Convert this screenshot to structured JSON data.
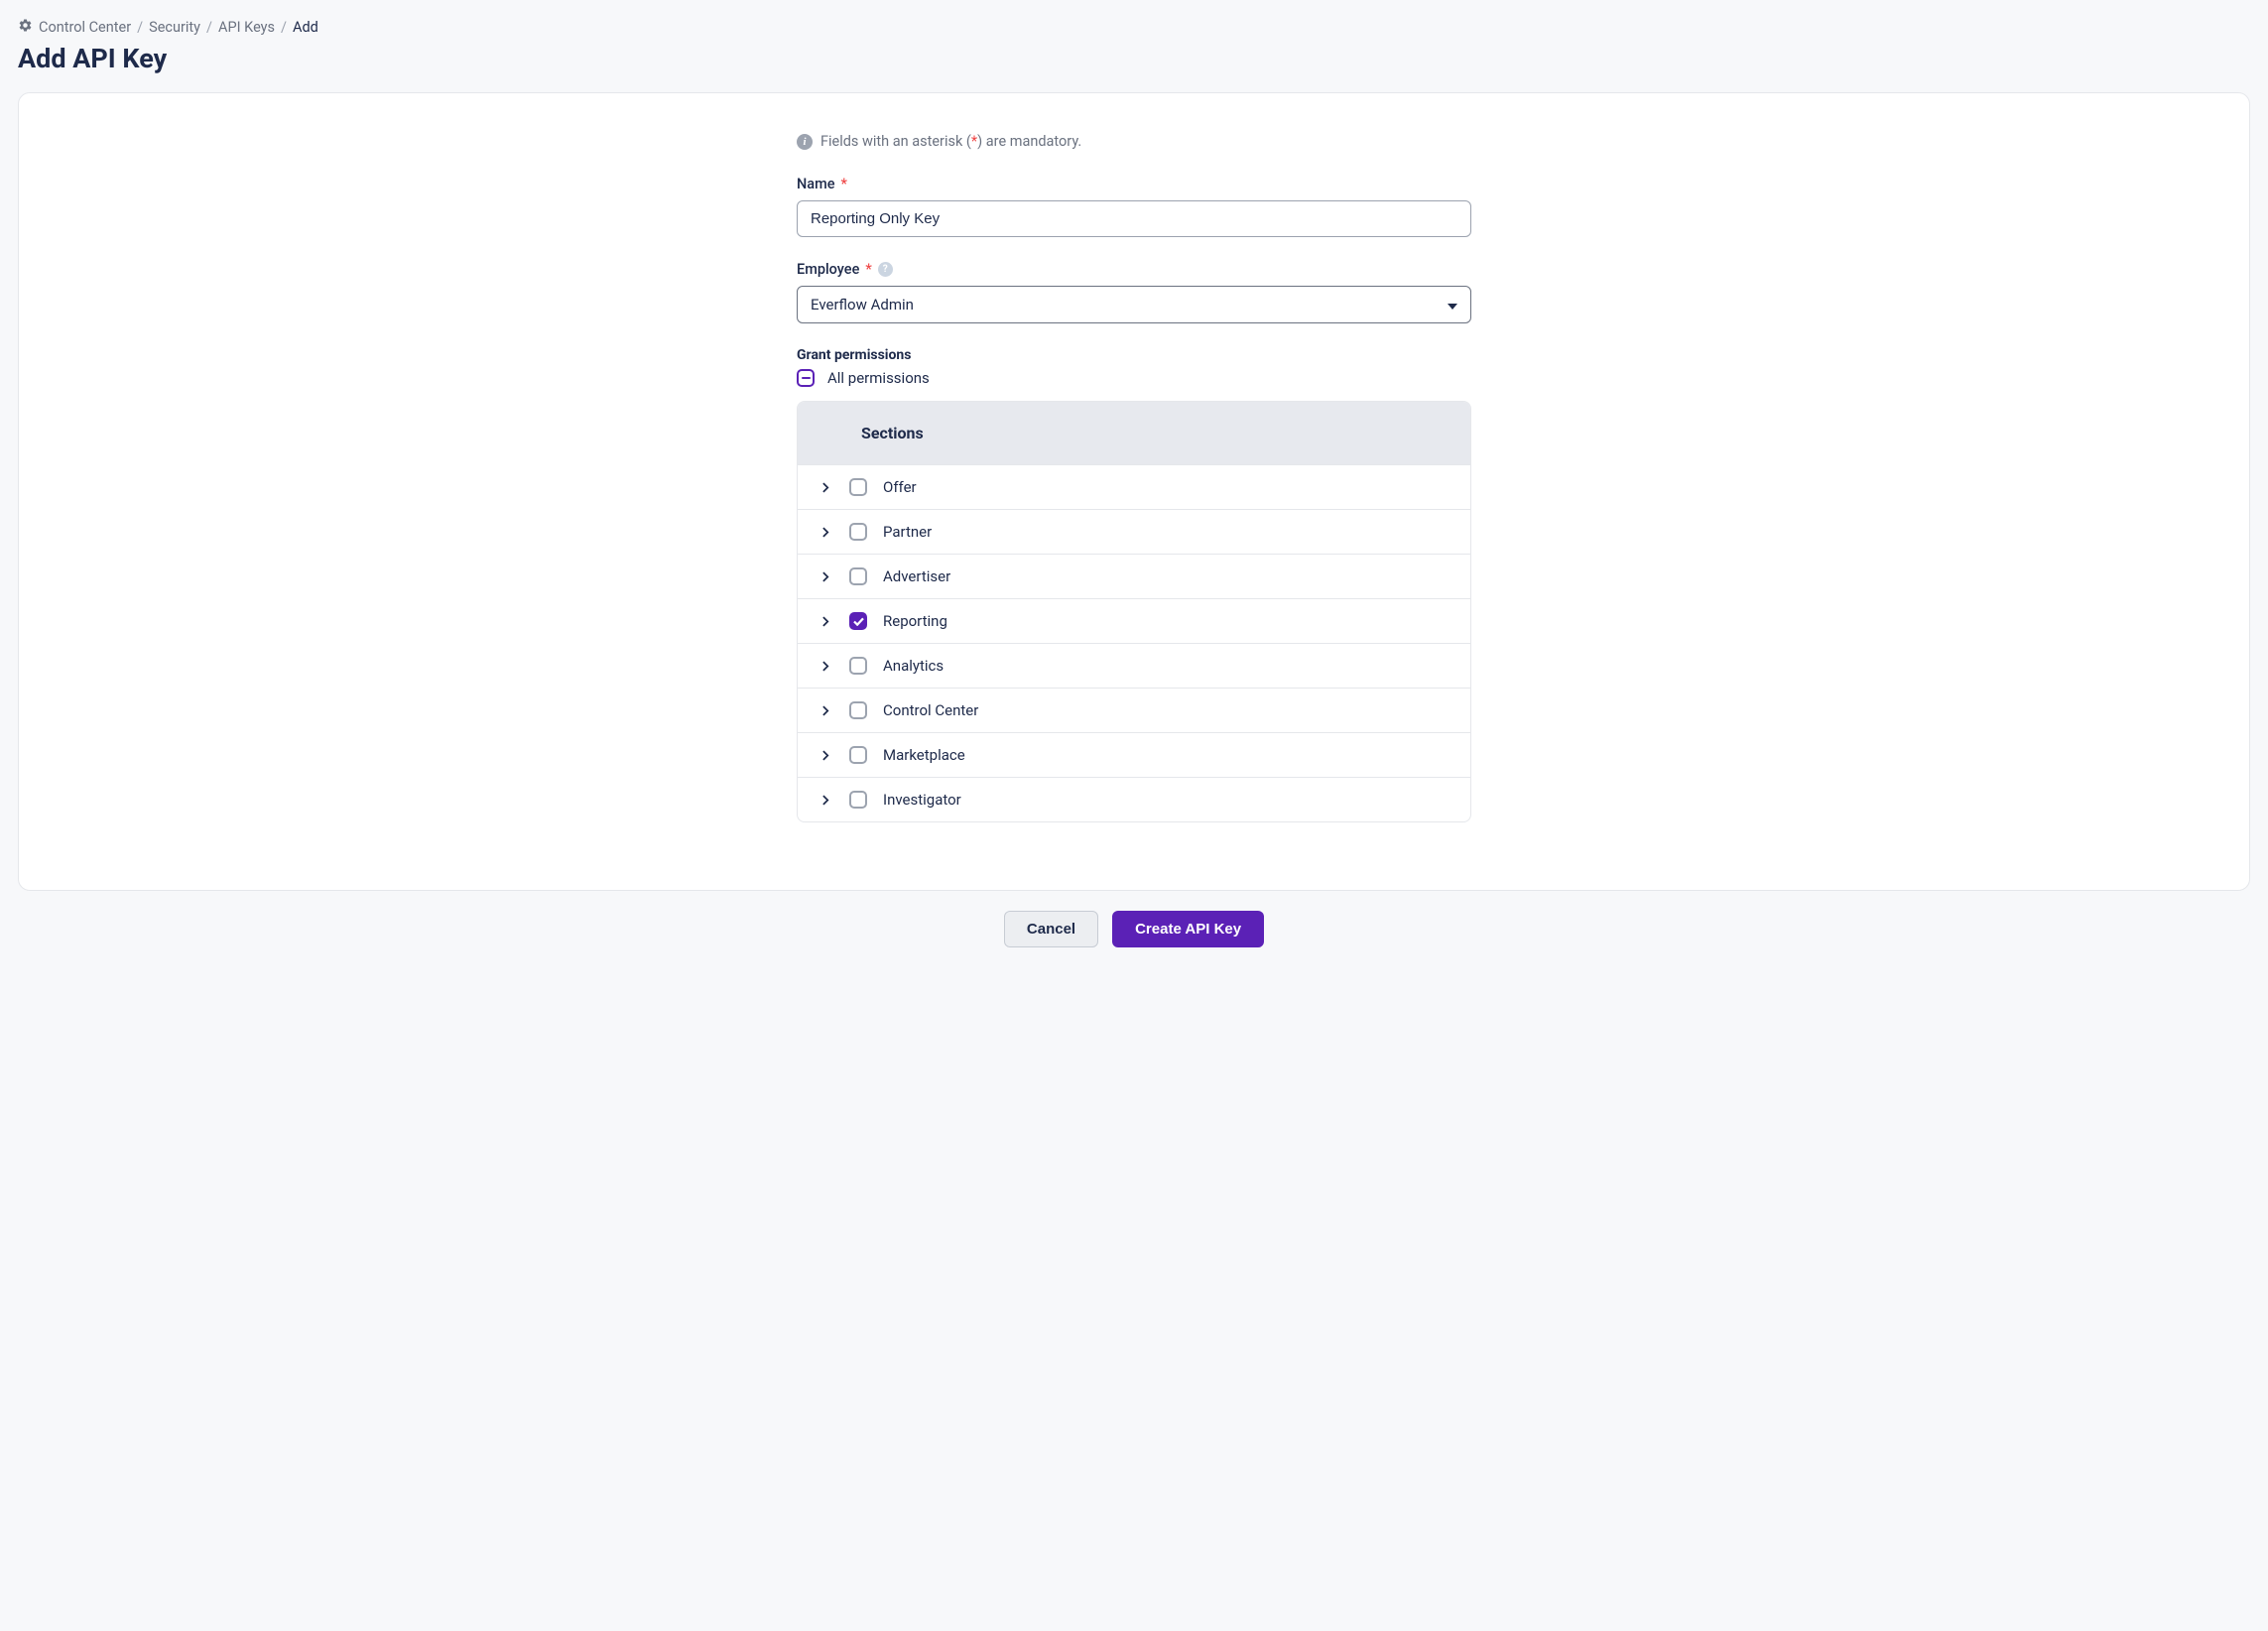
{
  "breadcrumb": {
    "items": [
      "Control Center",
      "Security",
      "API Keys"
    ],
    "current": "Add"
  },
  "page_title": "Add API Key",
  "info_text_pre": "Fields with an asterisk (",
  "info_text_mid": "*",
  "info_text_post": ") are mandatory.",
  "form": {
    "name_label": "Name",
    "name_value": "Reporting Only Key",
    "employee_label": "Employee",
    "employee_value": "Everflow Admin",
    "grant_label": "Grant permissions",
    "all_perm_label": "All permissions",
    "sections_header": "Sections",
    "sections": [
      {
        "label": "Offer",
        "checked": false
      },
      {
        "label": "Partner",
        "checked": false
      },
      {
        "label": "Advertiser",
        "checked": false
      },
      {
        "label": "Reporting",
        "checked": true
      },
      {
        "label": "Analytics",
        "checked": false
      },
      {
        "label": "Control Center",
        "checked": false
      },
      {
        "label": "Marketplace",
        "checked": false
      },
      {
        "label": "Investigator",
        "checked": false
      }
    ]
  },
  "buttons": {
    "cancel": "Cancel",
    "create": "Create API Key"
  }
}
